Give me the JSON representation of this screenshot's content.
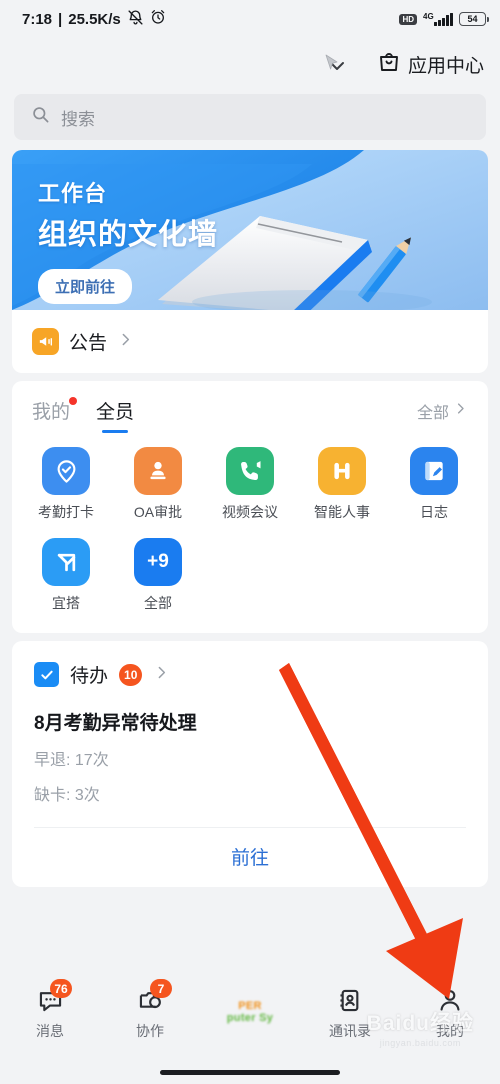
{
  "status_bar": {
    "time": "7:18",
    "separator": "|",
    "net_speed": "25.5K/s",
    "mute_icon": "bell-muted-icon",
    "alarm_icon": "alarm-clock-icon",
    "hd_label": "HD",
    "network_type": "4G",
    "battery_level": "54"
  },
  "header": {
    "chevron_icon": "chevron-down-icon",
    "cursor_icon": "cursor-arrow-icon",
    "app_center_icon": "shopping-bag-icon",
    "app_center_label": "应用中心"
  },
  "search": {
    "icon": "search-icon",
    "placeholder": "搜索"
  },
  "banner": {
    "eyebrow": "工作台",
    "title": "组织的文化墙",
    "cta_label": "立即前往",
    "bg_color": "#1a8cf5",
    "light_color": "#a9d5fb"
  },
  "notice": {
    "icon": "megaphone-icon",
    "label": "公告",
    "chevron_icon": "chevron-right-icon",
    "icon_color": "#f7a526"
  },
  "apps_section": {
    "tabs": [
      {
        "label": "我的",
        "active": false,
        "has_dot": true
      },
      {
        "label": "全员",
        "active": true,
        "has_dot": false
      }
    ],
    "more_label": "全部",
    "more_chevron_icon": "chevron-right-icon",
    "accent_color": "#1a7cf0",
    "items": [
      {
        "label": "考勤打卡",
        "icon": "location-check-icon",
        "color": "#3d8ef0"
      },
      {
        "label": "OA审批",
        "icon": "stamp-icon",
        "color": "#f28a42"
      },
      {
        "label": "视频会议",
        "icon": "video-call-icon",
        "color": "#2fb87a"
      },
      {
        "label": "智能人事",
        "icon": "hr-h-icon",
        "color": "#f7b231"
      },
      {
        "label": "日志",
        "icon": "notebook-pen-icon",
        "color": "#2b84ee"
      },
      {
        "label": "宜搭",
        "icon": "yida-y-icon",
        "color": "#2b9cf5"
      },
      {
        "label": "全部",
        "icon": "plus-nine-icon",
        "color": "#1a7cf0",
        "badge_text": "+9"
      }
    ]
  },
  "todo": {
    "checkbox_icon": "checkbox-checked-icon",
    "label": "待办",
    "count": "10",
    "chevron_icon": "chevron-right-icon",
    "item_title": "8月考勤异常待处理",
    "detail_lines": [
      "早退: 17次",
      "缺卡: 3次"
    ],
    "go_label": "前往",
    "go_color": "#2b6fd4",
    "badge_color": "#f5551f"
  },
  "annotation": {
    "arrow_icon": "red-arrow-icon",
    "color": "#ef3b14"
  },
  "bottom_nav": {
    "items": [
      {
        "label": "消息",
        "icon": "chat-bubble-icon",
        "badge": "76",
        "active": false
      },
      {
        "label": "协作",
        "icon": "collaboration-camera-icon",
        "badge": "7",
        "active": false
      },
      {
        "label": "",
        "icon": "company-logo-icon",
        "logo_line1": "PER",
        "logo_line2": "puter Sy",
        "active": false
      },
      {
        "label": "通讯录",
        "icon": "contacts-book-icon",
        "badge": "",
        "active": false
      },
      {
        "label": "我的",
        "icon": "person-icon",
        "badge": "",
        "active": false
      }
    ]
  },
  "watermark": {
    "line1": "Baidu经验",
    "line2": "jingyan.baidu.com"
  }
}
